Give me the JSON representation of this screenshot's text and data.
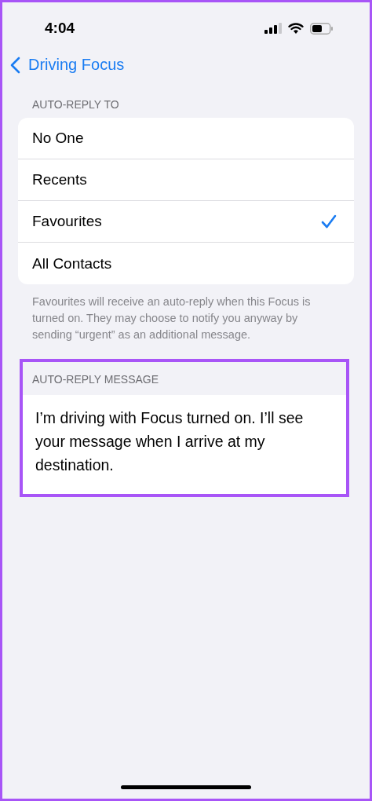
{
  "status_bar": {
    "time": "4:04"
  },
  "nav": {
    "back_label": "Driving Focus"
  },
  "auto_reply_to": {
    "header": "AUTO-REPLY TO",
    "options": [
      {
        "label": "No One",
        "selected": false
      },
      {
        "label": "Recents",
        "selected": false
      },
      {
        "label": "Favourites",
        "selected": true
      },
      {
        "label": "All Contacts",
        "selected": false
      }
    ],
    "footer": "Favourites will receive an auto-reply when this Focus is turned on. They may choose to notify you anyway by sending “urgent” as an additional message."
  },
  "auto_reply_message": {
    "header": "AUTO-REPLY MESSAGE",
    "highlighted": true,
    "value": "I’m driving with Focus turned on. I’ll see your message when I arrive at my destination."
  }
}
